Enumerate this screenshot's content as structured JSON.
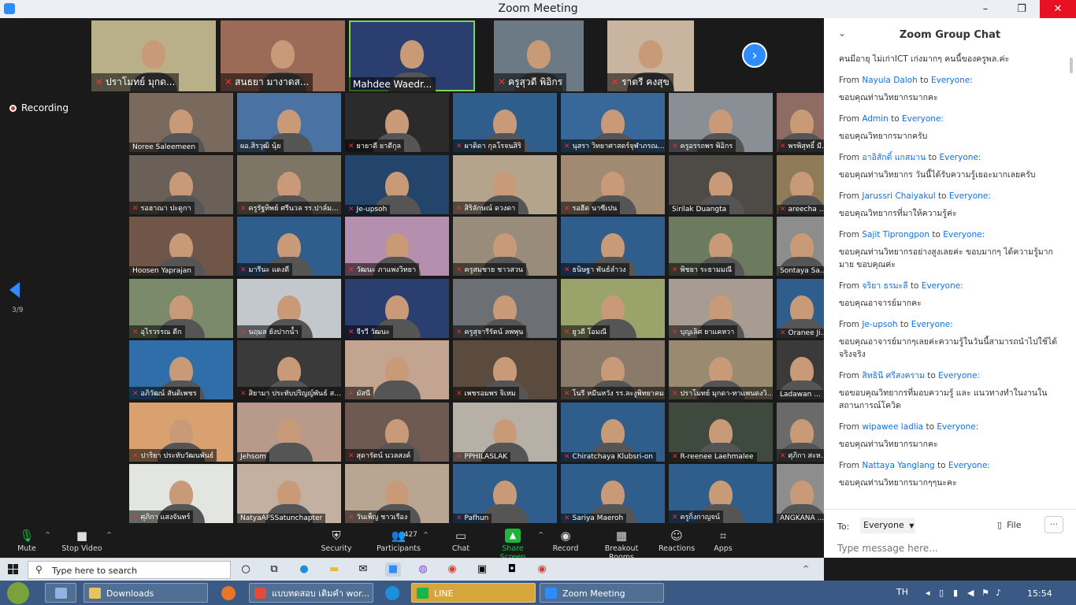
{
  "window": {
    "title": "Zoom Meeting",
    "minimize": "–",
    "maximize": "❐",
    "close": "✕"
  },
  "recording": {
    "label": "Recording"
  },
  "pagination": {
    "page": "3/9",
    "next": "›"
  },
  "strip_tiles": [
    {
      "name": "ปราโมทย์ มุกด...",
      "muted": true,
      "bg": "#b9b08a"
    },
    {
      "name": "สนธยา มางาดส...",
      "muted": true,
      "bg": "#9c6b58"
    },
    {
      "name": "Mahdee Waedr...",
      "muted": false,
      "bg": "#2a3e70",
      "active": true
    },
    {
      "name": "ครูสุวดี พิอิกร",
      "muted": true,
      "bg": "#6c7a86"
    },
    {
      "name": "ราตรี คงสุข",
      "muted": true,
      "bg": "#c9b4a0"
    }
  ],
  "grid_rows": [
    [
      {
        "name": "Noree Saleemeen",
        "muted": false,
        "bg": "#7a6a5e"
      },
      {
        "name": "ผอ.สิรวุฒิ นุ้ย",
        "muted": false,
        "bg": "#4a73a3"
      },
      {
        "name": "ยายาดี ยาดีกุล",
        "muted": true,
        "bg": "#2b2b2b"
      },
      {
        "name": "ผาติดา กุลโรจนสิริ",
        "muted": true,
        "bg": "#2f5e8c"
      },
      {
        "name": "นุสรา วิทยาศาสตร์จุฬาภรณร...",
        "muted": true,
        "bg": "#38689a"
      },
      {
        "name": "ครูอรรถพร พิอิกร",
        "muted": true,
        "bg": "#8a8f96"
      },
      {
        "name": "พรพิสุทธิ์ มีป...",
        "muted": true,
        "bg": "#8e6b63"
      }
    ],
    [
      {
        "name": "รอฮาณา ปะดูกา",
        "muted": true,
        "bg": "#6b6058"
      },
      {
        "name": "ครูรัฐทิพย์ ศรีนวล รร.ปาล์ม...",
        "muted": true,
        "bg": "#7d7566"
      },
      {
        "name": "Je-upsoh",
        "muted": true,
        "bg": "#23456b"
      },
      {
        "name": "สิริลักษณ์ ดวงดา",
        "muted": true,
        "bg": "#b5a48c"
      },
      {
        "name": "รอฮีด นาซีเปน",
        "muted": true,
        "bg": "#a08a72"
      },
      {
        "name": "Sirilak Duangta",
        "muted": false,
        "bg": "#4e4a46"
      },
      {
        "name": "areecha ma...",
        "muted": true,
        "bg": "#8f7b58"
      }
    ],
    [
      {
        "name": "Hoosen Yaprajan",
        "muted": false,
        "bg": "#6f5648"
      },
      {
        "name": "มารีนะ แดงดี",
        "muted": true,
        "bg": "#2f5e8c"
      },
      {
        "name": "วัฒนะ ภาแพงวิทยา",
        "muted": true,
        "bg": "#b58fae"
      },
      {
        "name": "ครูสมชาย ชาวสวน",
        "muted": true,
        "bg": "#9a8c7a"
      },
      {
        "name": "ธนิษฐา พันธ์ลำวง",
        "muted": true,
        "bg": "#2f5e8c"
      },
      {
        "name": "พิชยา ระธามมณี",
        "muted": true,
        "bg": "#6c7a5e"
      },
      {
        "name": "Sontaya Sa...",
        "muted": false,
        "bg": "#8d8d8d"
      }
    ],
    [
      {
        "name": "อุไรวรรณ ดีก",
        "muted": true,
        "bg": "#7a8a6a"
      },
      {
        "name": "นฤมล ยังปากน้ำ",
        "muted": true,
        "bg": "#c3c8cc"
      },
      {
        "name": "จีรวี วัฒนะ",
        "muted": true,
        "bg": "#2a3e70"
      },
      {
        "name": "ครูสุจารีรัตน์ ลพพุน",
        "muted": true,
        "bg": "#6c6f73"
      },
      {
        "name": "ยูวดี โอมณี",
        "muted": true,
        "bg": "#9aa36a"
      },
      {
        "name": "บุญเลิศ ยาแคหวา",
        "muted": true,
        "bg": "#a89c92"
      },
      {
        "name": "Oranee Jih...",
        "muted": true,
        "bg": "#2f5e8c"
      }
    ],
    [
      {
        "name": "อภิวัฒน์ สันติเพชร",
        "muted": true,
        "bg": "#2f6ea8"
      },
      {
        "name": "สิยามา ประทับปริญญ์พันธ์ สตูล...",
        "muted": true,
        "bg": "#3a3a3a"
      },
      {
        "name": "มัสนี",
        "muted": true,
        "bg": "#c2a490"
      },
      {
        "name": "เพชรอมพร จิเหม",
        "muted": true,
        "bg": "#5b4a3e"
      },
      {
        "name": "โนรี หมีนหวัง รร.ละงูพิทยาคม",
        "muted": true,
        "bg": "#8a7a6a"
      },
      {
        "name": "ปราโมทย์ มุกดา-ทาแพนดงวิทย...",
        "muted": true,
        "bg": "#9a8a70"
      },
      {
        "name": "Ladawan ...",
        "muted": false,
        "bg": "#3a3a3a"
      }
    ],
    [
      {
        "name": "ปาริยา ประทับวัฒนพันธ์",
        "muted": true,
        "bg": "#d9a070"
      },
      {
        "name": "Jehsom",
        "muted": false,
        "bg": "#b99a8a"
      },
      {
        "name": "สุดารัตน์ นวลสงค์",
        "muted": true,
        "bg": "#6f5a52"
      },
      {
        "name": "PPHILASLAK",
        "muted": true,
        "bg": "#b7b0a6"
      },
      {
        "name": "Chiratchaya Klubsri-on",
        "muted": true,
        "bg": "#2f5e8c"
      },
      {
        "name": "R-reenee Laehmalee",
        "muted": true,
        "bg": "#3e4a3e"
      },
      {
        "name": "ศุภิกา สะหม...",
        "muted": true,
        "bg": "#6a6a6a"
      }
    ],
    [
      {
        "name": "ศุภิกา แสงจันทร์",
        "muted": true,
        "bg": "#e3e6e0"
      },
      {
        "name": "NatyaAFSSatunchapter",
        "muted": false,
        "bg": "#c3b0a0"
      },
      {
        "name": "วันเพ็ญ ชาวเรือง",
        "muted": true,
        "bg": "#b8a592"
      },
      {
        "name": "Pafhun",
        "muted": true,
        "bg": "#2f5e8c"
      },
      {
        "name": "Sariya Maeroh",
        "muted": true,
        "bg": "#2f5e8c"
      },
      {
        "name": "ครูกิ่งกาญจน์",
        "muted": true,
        "bg": "#2f5e8c"
      },
      {
        "name": "ANGKANA ...",
        "muted": false,
        "bg": "#8d8d8d"
      }
    ]
  ],
  "toolbar": {
    "mute": "Mute",
    "stop_video": "Stop Video",
    "security": "Security",
    "participants": "Participants",
    "participants_count": "427",
    "chat": "Chat",
    "share_screen": "Share Screen",
    "record": "Record",
    "breakout_rooms": "Breakout Rooms",
    "reactions": "Reactions",
    "apps": "Apps"
  },
  "chat": {
    "title": "Zoom Group Chat",
    "to_label": "To:",
    "recipient": "Everyone",
    "file_label": "File",
    "more": "···",
    "placeholder": "Type message here...",
    "top_text": "คนมีอายุ ไม่เก่าICT เก่งมากๆ คนนี้ของครูพล.ค่ะ",
    "messages": [
      {
        "from": "Nayula Daloh",
        "to": "Everyone:",
        "text": "ขอบคุณท่านวิทยากรมากคะ"
      },
      {
        "from": "Admin",
        "to": "Everyone:",
        "text": "ขอบคุณวิทยากรมากครับ"
      },
      {
        "from": "อาอิสักดิ์ แกสมาน",
        "to": "Everyone:",
        "text": "ขอบคุณท่านวิทยากร วันนี้ได้รับความรู้เยอะมากเลยครับ"
      },
      {
        "from": "Jarussri Chaiyakul",
        "to": "Everyone:",
        "text": "ขอบคุณวิทยากรที่มาให้ความรู้ค่ะ"
      },
      {
        "from": "Sajit Tiprongpon",
        "to": "Everyone:",
        "text": "ขอบคุณท่านวิทยากรอย่างสูงเลยค่ะ ขอบมากๆ ได้ความรู้มากมาย ขอบคุณค่ะ"
      },
      {
        "from": "จริยา ธรมะลี",
        "to": "Everyone:",
        "text": "ขอบคุณอาจารย์มากคะ"
      },
      {
        "from": "Je-upsoh",
        "to": "Everyone:",
        "text": "ขอบคุณอาจารย์มากๆเลยค่ะความรู้ในวันนี้สามารถนำไปใช้ได้จริงจริง"
      },
      {
        "from": "สิทธินี ศรีสงคราม",
        "to": "Everyone:",
        "text": "ขอขอบคุณวิทยากรที่มอบความรู้ และ แนวทางทำในงานในสถานการณ์โควิด"
      },
      {
        "from": "wipawee ladlia",
        "to": "Everyone:",
        "text": "ขอบคุณท่านวิทยากรมากคะ"
      },
      {
        "from": "Nattaya Yanglang",
        "to": "Everyone:",
        "text": "ขอบคุณท่านวิทยากรมากๆๆนะคะ"
      }
    ]
  },
  "taskbar": {
    "search_placeholder": "Type here to search",
    "windows": [
      {
        "label": "Downloads",
        "color": "#e8c25a"
      },
      {
        "label": "แบบทดสอบ เติมคำ wor...",
        "color": "#e04b3a"
      },
      {
        "label": "LINE",
        "color": "#17b64a"
      },
      {
        "label": "Zoom Meeting",
        "color": "#2d8cff"
      }
    ],
    "lang": "TH",
    "time": "15:54"
  },
  "colors": {
    "accent": "#2d8cff",
    "chat_name": "#0e71eb",
    "share_green": "#21b33b",
    "muted_red": "#e33333"
  }
}
